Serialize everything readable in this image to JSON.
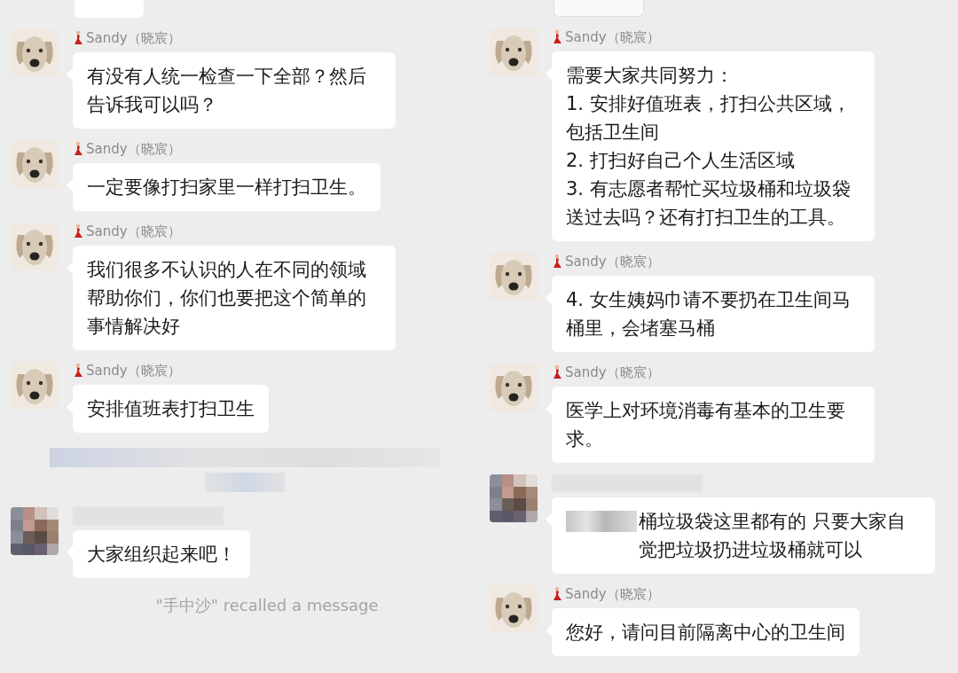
{
  "columns": [
    {
      "messages": [
        {
          "kind": "cut_bubble"
        },
        {
          "kind": "message",
          "avatar": {
            "kind": "dog"
          },
          "name": "Sandy（晓宸）",
          "text": "有没有人统一检查一下全部？然后告诉我可以吗？"
        },
        {
          "kind": "message",
          "avatar": {
            "kind": "dog"
          },
          "name": "Sandy（晓宸）",
          "text": "一定要像打扫家里一样打扫卫生。"
        },
        {
          "kind": "message",
          "avatar": {
            "kind": "dog"
          },
          "name": "Sandy（晓宸）",
          "text": "我们很多不认识的人在不同的领域帮助你们，你们也要把这个简单的事情解决好"
        },
        {
          "kind": "message",
          "avatar": {
            "kind": "dog"
          },
          "name": "Sandy（晓宸）",
          "text": "安排值班表打扫卫生"
        },
        {
          "kind": "redacted_notice"
        },
        {
          "kind": "message",
          "avatar": {
            "kind": "blurred"
          },
          "text": "大家组织起来吧！"
        },
        {
          "kind": "notice",
          "text": "\"手中沙\" recalled a message"
        }
      ]
    },
    {
      "messages": [
        {
          "kind": "cut_image"
        },
        {
          "kind": "message",
          "avatar": {
            "kind": "dog"
          },
          "name": "Sandy（晓宸）",
          "text": "需要大家共同努力：\n1. 安排好值班表，打扫公共区域，包括卫生间\n2. 打扫好自己个人生活区域\n3. 有志愿者帮忙买垃圾桶和垃圾袋送过去吗？还有打扫卫生的工具。"
        },
        {
          "kind": "message",
          "avatar": {
            "kind": "dog"
          },
          "name": "Sandy（晓宸）",
          "text": "4. 女生姨妈巾请不要扔在卫生间马桶里，会堵塞马桶"
        },
        {
          "kind": "message",
          "avatar": {
            "kind": "dog"
          },
          "name": "Sandy（晓宸）",
          "text": "医学上对环境消毒有基本的卫生要求。"
        },
        {
          "kind": "message",
          "avatar": {
            "kind": "blurred"
          },
          "redacted_prefix": true,
          "text": "桶垃圾袋这里都有的 只要大家自觉把垃圾扔进垃圾桶就可以"
        },
        {
          "kind": "message",
          "avatar": {
            "kind": "dog"
          },
          "name": "Sandy（晓宸）",
          "text": "您好，请问目前隔离中心的卫生间"
        }
      ]
    }
  ]
}
